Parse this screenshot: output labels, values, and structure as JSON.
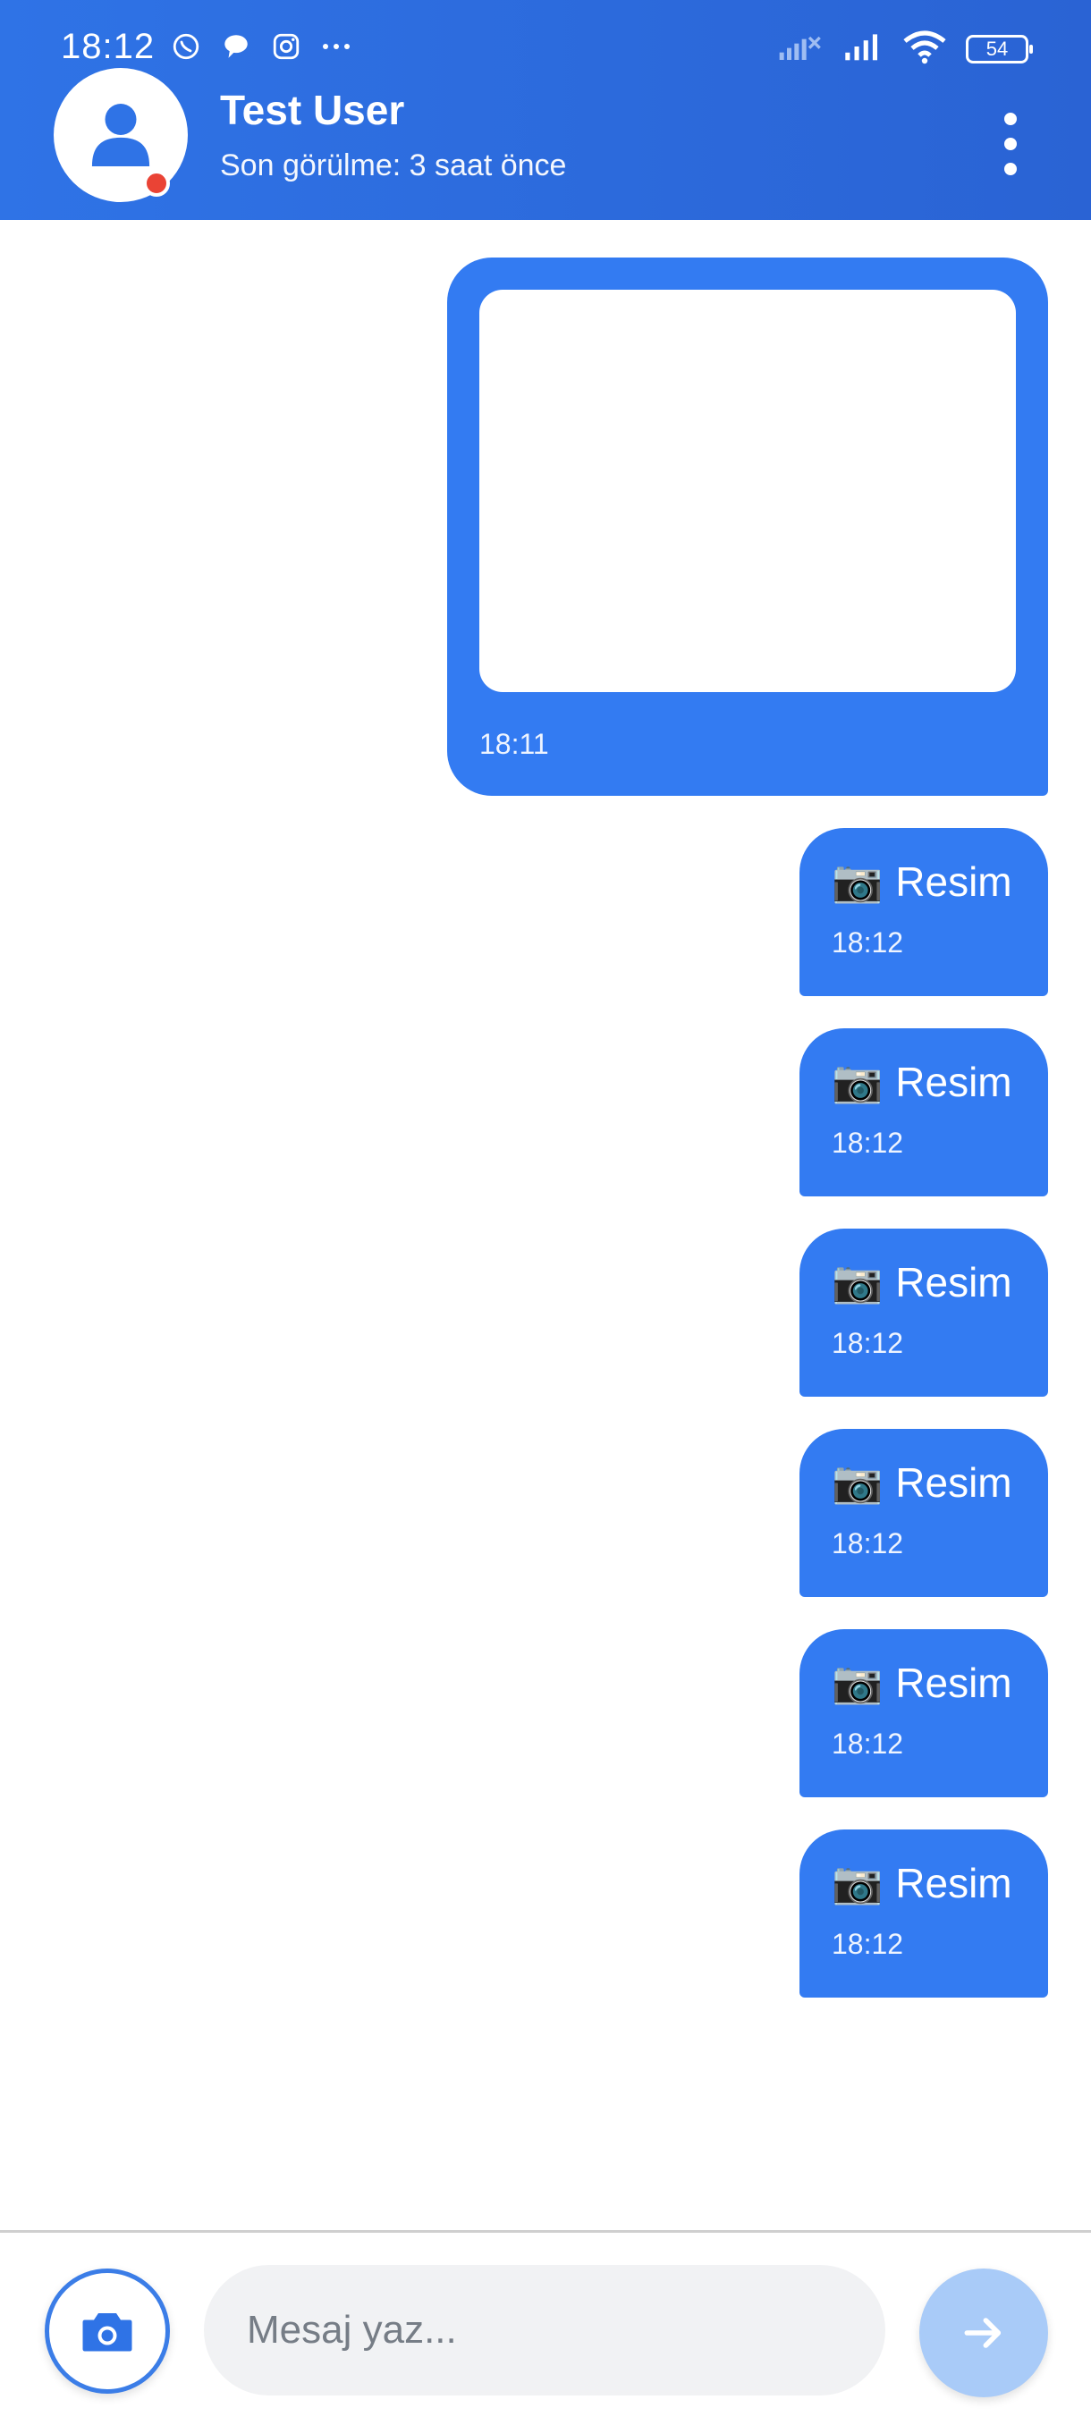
{
  "status_bar": {
    "time": "18:12",
    "battery": "54"
  },
  "header": {
    "name": "Test User",
    "last_seen": "Son görülme: 3 saat önce"
  },
  "messages": {
    "image_msg": {
      "time": "18:11"
    },
    "resim": [
      {
        "label": "Resim",
        "time": "18:12"
      },
      {
        "label": "Resim",
        "time": "18:12"
      },
      {
        "label": "Resim",
        "time": "18:12"
      },
      {
        "label": "Resim",
        "time": "18:12"
      },
      {
        "label": "Resim",
        "time": "18:12"
      },
      {
        "label": "Resim",
        "time": "18:12"
      }
    ]
  },
  "composer": {
    "placeholder": "Mesaj yaz..."
  },
  "colors": {
    "primary": "#337bf2",
    "header": "#2f73e6",
    "send_disabled": "#a9cbf8",
    "online": "#ea4335"
  }
}
